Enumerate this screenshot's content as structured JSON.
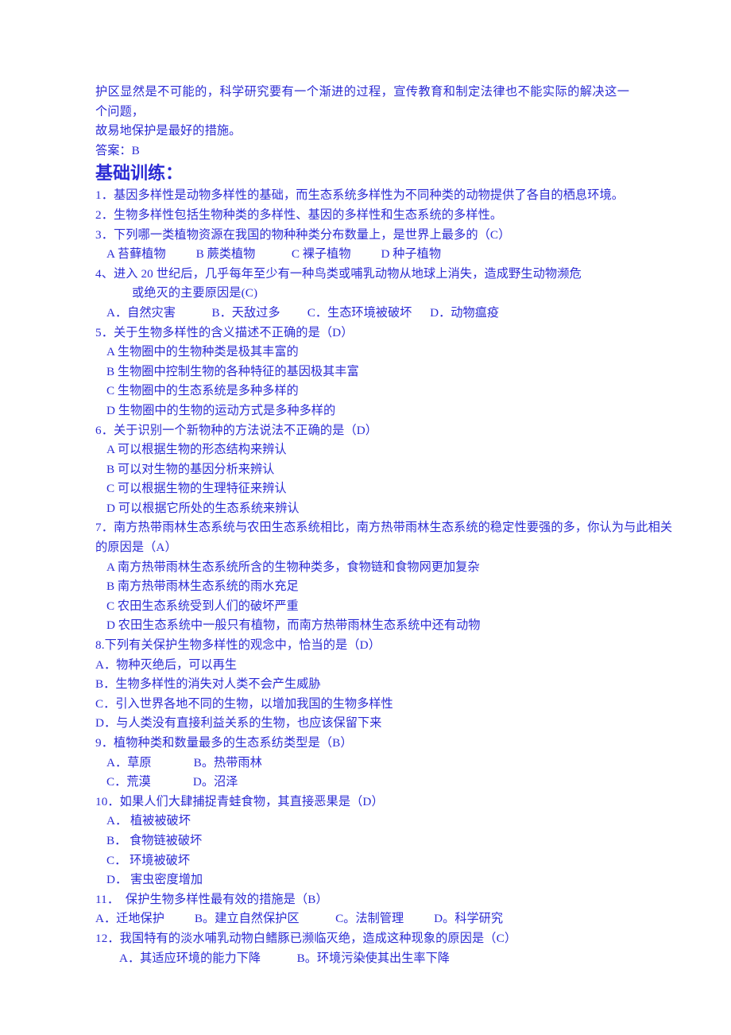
{
  "document": {
    "text_color": "#2b2bd4",
    "background_color": "#ffffff",
    "intro": {
      "line1": "护区显然是不可能的，科学研究要有一个渐进的过程，宣传教育和制定法律也不能实际的解决这一个问题，",
      "line2": "故易地保护是最好的措施。",
      "answer": "答案：B"
    },
    "heading": "基础训练：",
    "questions": [
      {
        "number": "1",
        "stem": "1．基因多样性是动物多样性的基础，而生态系统多样性为不同种类的动物提供了各自的栖息环境。",
        "options": []
      },
      {
        "number": "2",
        "stem": "2．生物多样性包括生物种类的多样性、基因的多样性和生态系统的多样性。",
        "options": []
      },
      {
        "number": "3",
        "stem": "3．下列哪一类植物资源在我国的物种种类分布数量上，是世界上最多的（C）",
        "options_inline": "A 苔藓植物          B 蕨类植物            C 裸子植物          D 种子植物"
      },
      {
        "number": "4",
        "stem_line1": "4、进入 20 世纪后，几乎每年至少有一种鸟类或哺乳动物从地球上消失，造成野生动物濒危",
        "stem_line2": "或绝灭的主要原因是(C)",
        "options_inline": "A．自然灾害            B．天敌过多         C．生态环境被破坏      D．动物瘟疫"
      },
      {
        "number": "5",
        "stem": "5．关于生物多样性的含义描述不正确的是（D）",
        "options": [
          "A 生物圈中的生物种类是极其丰富的",
          "B 生物圈中控制生物的各种特征的基因极其丰富",
          "C 生物圈中的生态系统是多种多样的",
          "D 生物圈中的生物的运动方式是多种多样的"
        ]
      },
      {
        "number": "6",
        "stem": "6．关于识别一个新物种的方法说法不正确的是（D）",
        "options": [
          "A 可以根据生物的形态结构来辨认",
          "B 可以对生物的基因分析来辨认",
          "C 可以根据生物的生理特征来辨认",
          "D 可以根据它所处的生态系统来辨认"
        ]
      },
      {
        "number": "7",
        "stem_line1": "7．南方热带雨林生态系统与农田生态系统相比，南方热带雨林生态系统的稳定性要强的多，你认为与此相关",
        "stem_line2": "的原因是（A）",
        "options": [
          "A 南方热带雨林生态系统所含的生物种类多，食物链和食物网更加复杂",
          "B 南方热带雨林生态系统的雨水充足",
          "C 农田生态系统受到人们的破坏严重",
          "D 农田生态系统中一般只有植物，而南方热带雨林生态系统中还有动物"
        ]
      },
      {
        "number": "8",
        "stem": "8.下列有关保护生物多样性的观念中，恰当的是（D）",
        "options": [
          "A．物种灭绝后，可以再生",
          "B．生物多样性的消失对人类不会产生威胁",
          "C．引入世界各地不同的生物，以增加我国的生物多样性",
          "D．与人类没有直接利益关系的生物，也应该保留下来"
        ]
      },
      {
        "number": "9",
        "stem": "9．植物种类和数量最多的生态系纺类型是（B）",
        "options_inline_rows": [
          "A．草原              B。热带雨林",
          "C．荒漠              D。沼泽"
        ]
      },
      {
        "number": "10",
        "stem": "10．如果人们大肆捕捉青蛙食物，其直接恶果是（D）",
        "options": [
          "A． 植被被破坏",
          "B． 食物链被破坏",
          "C． 环境被破坏",
          "D． 害虫密度增加"
        ]
      },
      {
        "number": "11",
        "stem": "11．  保护生物多样性最有效的措施是（B）",
        "options_inline": "A．迁地保护          B。建立自然保护区            C。法制管理          D。科学研究"
      },
      {
        "number": "12",
        "stem": "12．我国特有的淡水哺乳动物白鳍豚已濒临灭绝，造成这种现象的原因是（C）",
        "options_inline": "A．其适应环境的能力下降            B。环境污染使其出生率下降"
      }
    ]
  }
}
